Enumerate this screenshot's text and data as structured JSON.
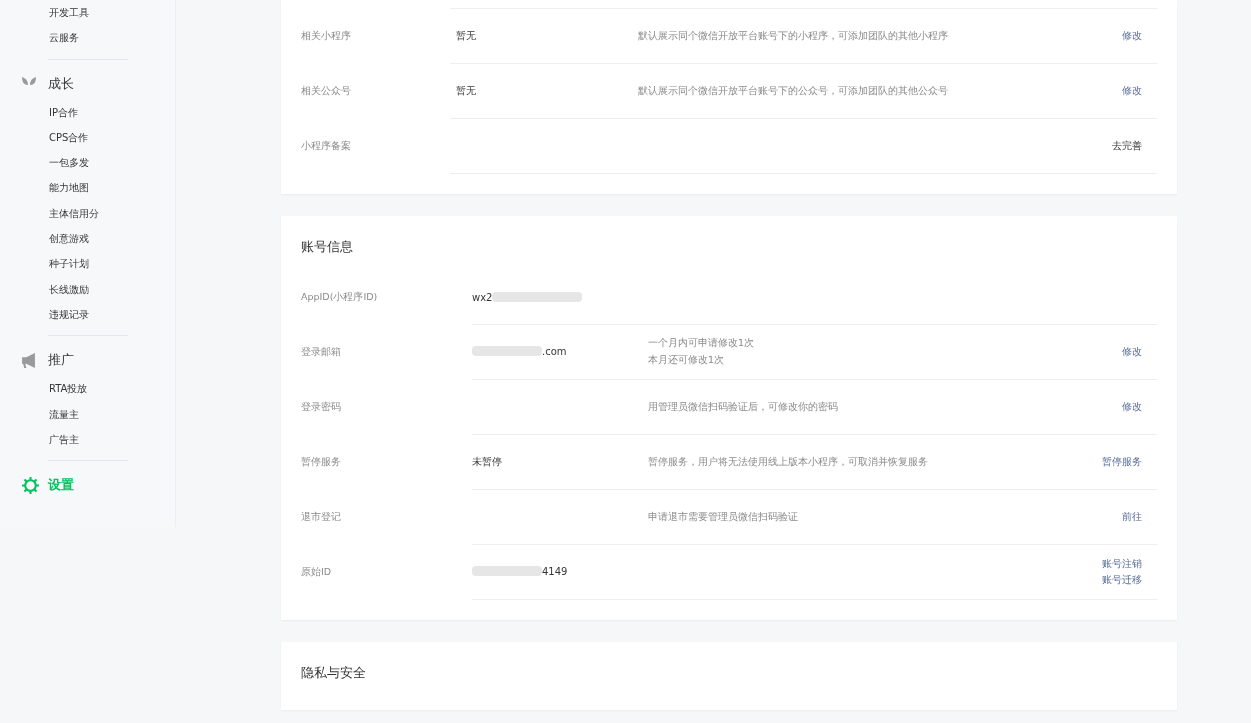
{
  "sidebar": {
    "groups": [
      {
        "items": [
          {
            "label": "开发工具",
            "selected": false
          },
          {
            "label": "云服务",
            "selected": false
          }
        ]
      },
      {
        "header": {
          "label": "成长",
          "kind": "leaf",
          "selected": false
        },
        "items": [
          {
            "label": "IP合作",
            "selected": false
          },
          {
            "label": "CPS合作",
            "selected": false
          },
          {
            "label": "一包多发",
            "selected": false
          },
          {
            "label": "能力地图",
            "selected": false
          },
          {
            "label": "主体信用分",
            "selected": false
          },
          {
            "label": "创意游戏",
            "selected": false
          },
          {
            "label": "种子计划",
            "selected": false
          },
          {
            "label": "长线激励",
            "selected": false
          },
          {
            "label": "违规记录",
            "selected": false
          }
        ]
      },
      {
        "header": {
          "label": "推广",
          "kind": "megaphone",
          "selected": false
        },
        "items": [
          {
            "label": "RTA投放",
            "selected": false
          },
          {
            "label": "流量主",
            "selected": false
          },
          {
            "label": "广告主",
            "selected": false
          }
        ]
      },
      {
        "header": {
          "label": "设置",
          "kind": "gear",
          "selected": true
        }
      }
    ]
  },
  "cards": [
    {
      "rows": [
        {
          "label": "相关小程序",
          "value": {
            "text": "暂无",
            "kind": "plain"
          },
          "description": [
            "默认展示同个微信开放平台账号下的小程序，可添加团队的其他小程序"
          ],
          "actions": [
            {
              "label": "修改",
              "kind": "link"
            }
          ]
        },
        {
          "label": "相关公众号",
          "value": {
            "text": "暂无",
            "kind": "plain"
          },
          "description": [
            "默认展示同个微信开放平台账号下的公众号，可添加团队的其他公众号"
          ],
          "actions": [
            {
              "label": "修改",
              "kind": "link"
            }
          ]
        },
        {
          "label": "小程序备案",
          "actions": [
            {
              "label": "去完善",
              "kind": "text"
            }
          ]
        }
      ]
    },
    {
      "title": "账号信息",
      "rows": [
        {
          "label": "AppID(小程序ID)",
          "value": {
            "text": "wx2",
            "kind": "blurred_tail"
          }
        },
        {
          "label": "登录邮箱",
          "value": {
            "text": ".com",
            "kind": "blurred_head"
          },
          "description": [
            "一个月内可申请修改1次",
            "本月还可修改1次"
          ],
          "actions": [
            {
              "label": "修改",
              "kind": "link"
            }
          ]
        },
        {
          "label": "登录密码",
          "description": [
            "用管理员微信扫码验证后，可修改你的密码"
          ],
          "actions": [
            {
              "label": "修改",
              "kind": "link"
            }
          ]
        },
        {
          "label": "暂停服务",
          "value": {
            "text": "未暂停",
            "kind": "plain"
          },
          "description": [
            "暂停服务，用户将无法使用线上版本小程序，可取消并恢复服务"
          ],
          "actions": [
            {
              "label": "暂停服务",
              "kind": "link"
            }
          ]
        },
        {
          "label": "退市登记",
          "description": [
            "申请退市需要管理员微信扫码验证"
          ],
          "actions": [
            {
              "label": "前往",
              "kind": "link"
            }
          ]
        },
        {
          "label": "原始ID",
          "value": {
            "text": "4149",
            "kind": "blurred_head"
          },
          "actions": [
            {
              "label": "账号注销",
              "kind": "link"
            },
            {
              "label": "账号迁移",
              "kind": "link"
            }
          ]
        }
      ]
    },
    {
      "title": "隐私与安全"
    }
  ]
}
